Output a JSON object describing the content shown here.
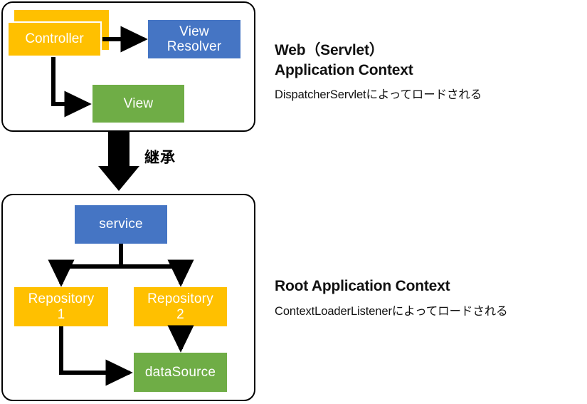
{
  "diagram": {
    "title_implied": "Spring application context hierarchy",
    "colors": {
      "yellow": "#FFC000",
      "blue": "#4575C4",
      "green": "#6FAD46",
      "outline": "#000000",
      "text_on_node": "#FFFFFF",
      "text_body": "#111111",
      "background": "#FFFFFF"
    },
    "web_context": {
      "nodes": {
        "controller": "Controller",
        "view_resolver": "View\nResolver",
        "view": "View"
      }
    },
    "inheritance": {
      "label": "継承"
    },
    "root_context": {
      "nodes": {
        "service": "service",
        "repository1": "Repository\n1",
        "repository2": "Repository\n2",
        "datasource": "dataSource"
      }
    },
    "annotations": {
      "web": {
        "heading": "Web（Servlet）\nApplication Context",
        "subtext": "DispatcherServletによってロードされる"
      },
      "root": {
        "heading": "Root Application Context",
        "subtext": "ContextLoaderListenerによってロードされる"
      }
    }
  }
}
